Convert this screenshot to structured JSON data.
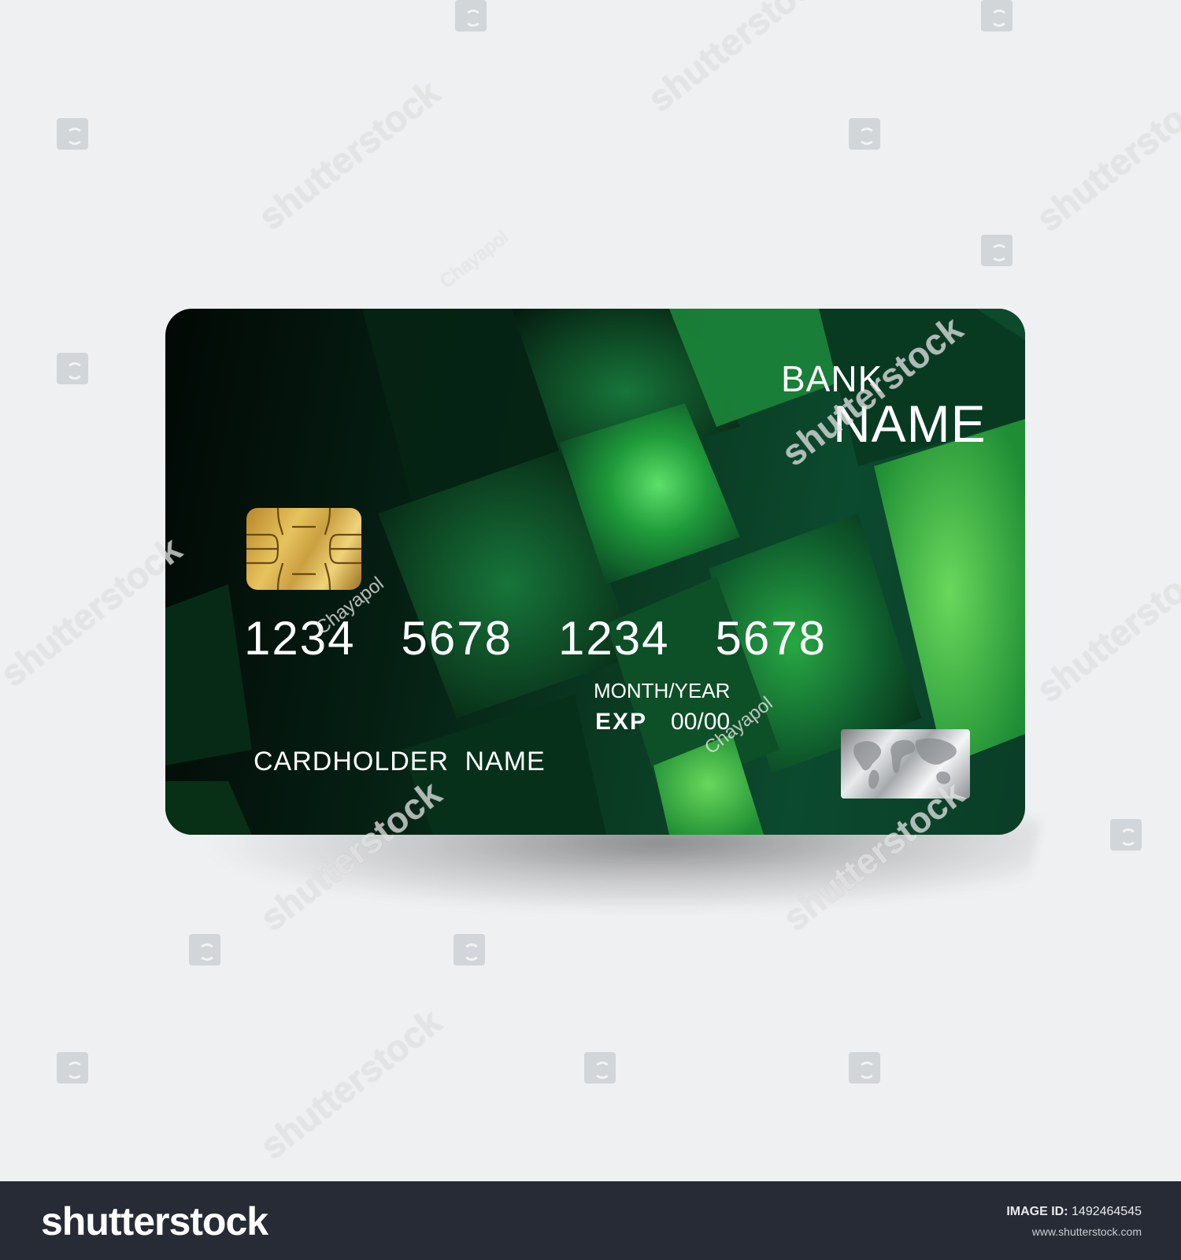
{
  "card": {
    "bank_name_line1": "BANK",
    "bank_name_line2": "NAME",
    "number_groups": [
      "1234",
      "5678",
      "1234",
      "5678"
    ],
    "expiry_caption": "MONTH/YEAR",
    "expiry_label": "EXP",
    "expiry_value": "00/00",
    "cardholder": "CARDHOLDER  NAME",
    "chip_icon": "emv-chip-icon",
    "hologram_icon": "world-map-hologram-icon"
  },
  "watermark": {
    "brand": "shutterstock",
    "author": "Chayapol"
  },
  "footer": {
    "brand": "shutterstock",
    "image_id_label": "IMAGE ID:",
    "image_id_value": "1492464545",
    "site": "www.shutterstock.com"
  },
  "colors": {
    "background": "#eef0f2",
    "card_dark": "#020805",
    "card_green": "#3fcf54",
    "chip_gold": "#d8b14a",
    "footer_bg": "#262b35"
  }
}
